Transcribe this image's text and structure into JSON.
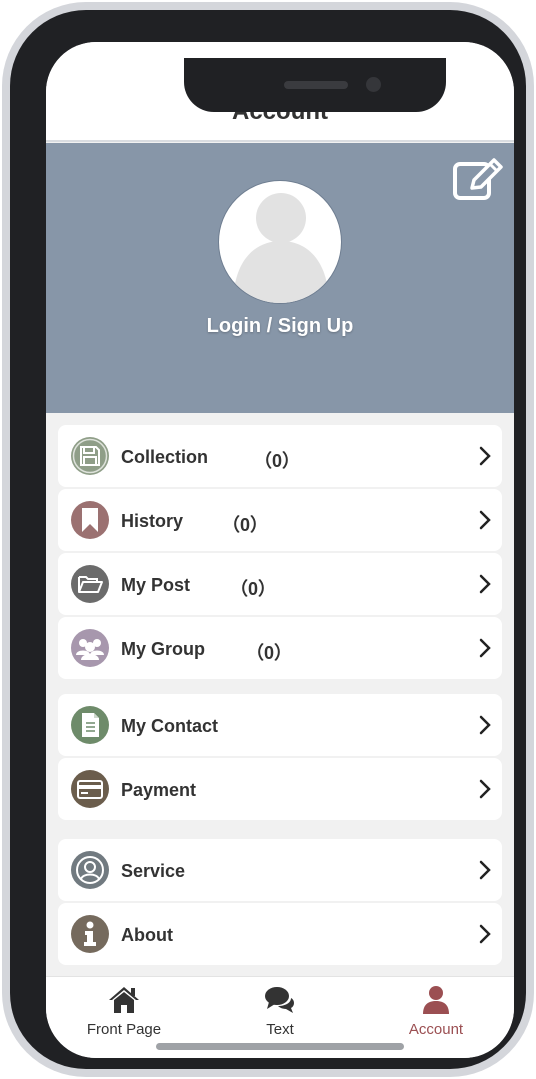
{
  "header": {
    "title": "Account"
  },
  "profile": {
    "login_label": "Login / Sign Up"
  },
  "menu": {
    "group1": [
      {
        "label": "Collection",
        "count": "（0）",
        "icon": "floppy-disk-icon",
        "color": "#8f9e88"
      },
      {
        "label": "History",
        "count": "（0）",
        "icon": "bookmark-icon",
        "color": "#9b7171"
      },
      {
        "label": "My Post",
        "count": "（0）",
        "icon": "folder-open-icon",
        "color": "#6b6b6b"
      },
      {
        "label": "My Group",
        "count": "（0）",
        "icon": "group-icon",
        "color": "#a797ad"
      }
    ],
    "group2": [
      {
        "label": "My Contact",
        "icon": "document-icon",
        "color": "#6e8b6a"
      },
      {
        "label": "Payment",
        "icon": "credit-card-icon",
        "color": "#6b5d4c"
      }
    ],
    "group3": [
      {
        "label": "Service",
        "icon": "user-circle-icon",
        "color": "#717a80"
      },
      {
        "label": "About",
        "icon": "info-icon",
        "color": "#756a5d"
      }
    ]
  },
  "tabbar": {
    "tabs": [
      {
        "label": "Front Page",
        "icon": "home-icon"
      },
      {
        "label": "Text",
        "icon": "chat-bubbles-icon"
      },
      {
        "label": "Account",
        "icon": "user-icon",
        "active": true
      }
    ],
    "active_color": "#9b4f52"
  }
}
